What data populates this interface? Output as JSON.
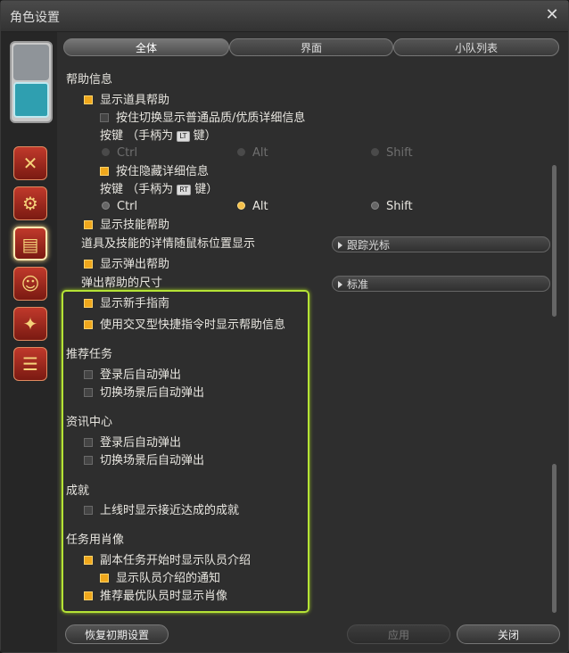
{
  "window": {
    "title": "角色设置"
  },
  "tabs": [
    {
      "label": "全体",
      "active": true
    },
    {
      "label": "界面",
      "active": false
    },
    {
      "label": "小队列表",
      "active": false
    }
  ],
  "help": {
    "section": "帮助信息",
    "item_help": "显示道具帮助",
    "hold_switch": "按住切换显示普通品质/优质详细信息",
    "key_label_1": "按键 （手柄为",
    "key_icon_1": "LT",
    "key_suffix": "键）",
    "radio_ctrl": "Ctrl",
    "radio_alt": "Alt",
    "radio_shift": "Shift",
    "hold_hide": "按住隐藏详细信息",
    "key_label_2": "按键 （手柄为",
    "key_icon_2": "RT",
    "skill_help": "显示技能帮助",
    "mouse_pos_label": "道具及技能的详情随鼠标位置显示",
    "mouse_pos_value": "跟踪光标",
    "popup_help": "显示弹出帮助",
    "popup_size_label": "弹出帮助的尺寸",
    "popup_size_value": "标准",
    "newbie_guide": "显示新手指南",
    "cross_hotbar_help": "使用交叉型快捷指令时显示帮助信息"
  },
  "recommended": {
    "section": "推荐任务",
    "login_popup": "登录后自动弹出",
    "zone_popup": "切换场景后自动弹出"
  },
  "news": {
    "section": "资讯中心",
    "login_popup": "登录后自动弹出",
    "zone_popup": "切换场景后自动弹出"
  },
  "achievements": {
    "section": "成就",
    "near_complete": "上线时显示接近达成的成就"
  },
  "portraits": {
    "section": "任务用肖像",
    "duty_start": "副本任务开始时显示队员介绍",
    "intro_notice": "显示队员介绍的通知",
    "recommend_portrait": "推荐最优队员时显示肖像"
  },
  "footer": {
    "reset": "恢复初期设置",
    "apply": "应用",
    "close": "关闭"
  }
}
